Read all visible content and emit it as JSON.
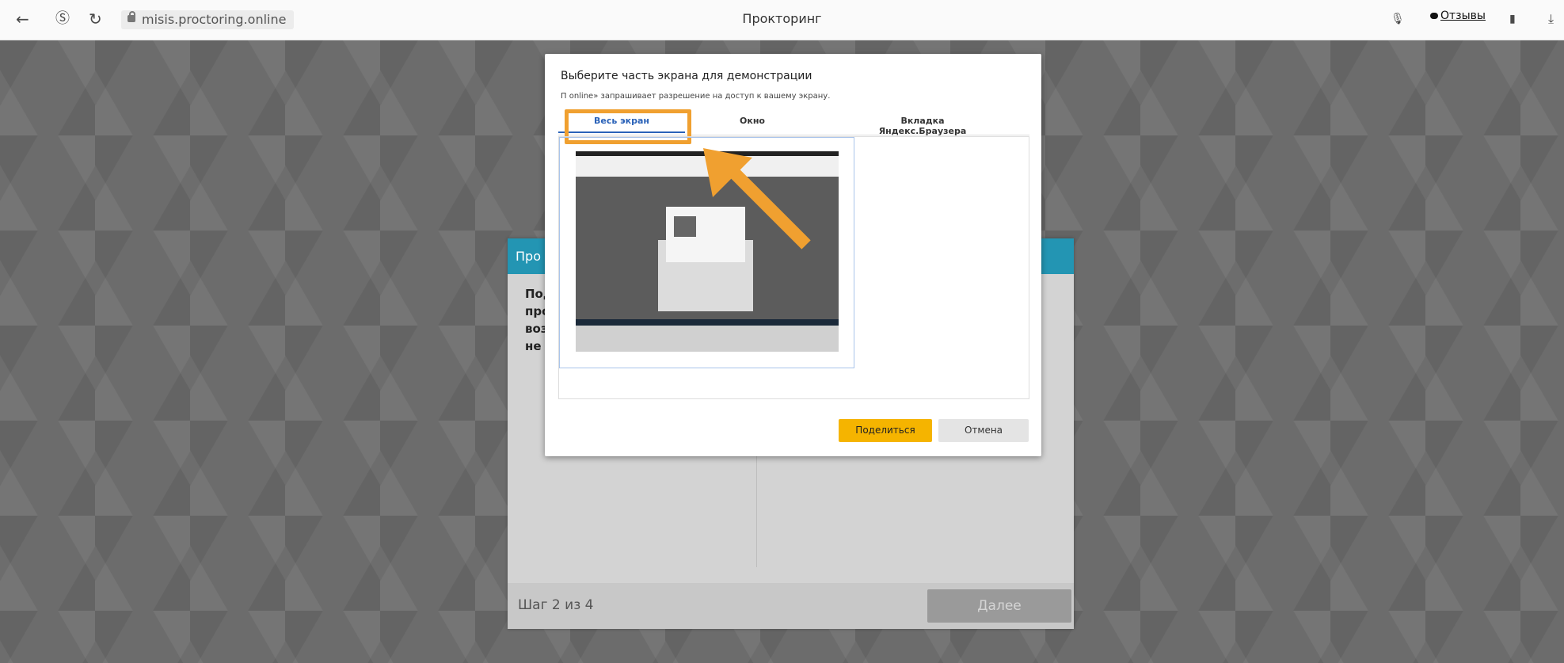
{
  "browser": {
    "url": "misis.proctoring.online",
    "page_title": "Прокторинг",
    "reviews_label": "Отзывы"
  },
  "wizard": {
    "header": "Про",
    "body_lines": "Под\nпро\nвоз\nне г",
    "step": "Шаг 2 из 4",
    "next_label": "Далее"
  },
  "share_dialog": {
    "title": "Выберите часть экрана для демонстрации",
    "subtitle": "П                         online» запрашивает разрешение на доступ к вашему экрану.",
    "tabs": [
      {
        "label": "Весь экран",
        "active": true
      },
      {
        "label": "Окно",
        "active": false
      },
      {
        "label": "Вкладка Яндекс.Браузера",
        "active": false
      }
    ],
    "share_label": "Поделиться",
    "cancel_label": "Отмена"
  },
  "colors": {
    "accent_orange": "#f0a030",
    "share_yellow": "#f5b400",
    "header_teal": "#2395b3",
    "tab_blue": "#2a62b8"
  }
}
